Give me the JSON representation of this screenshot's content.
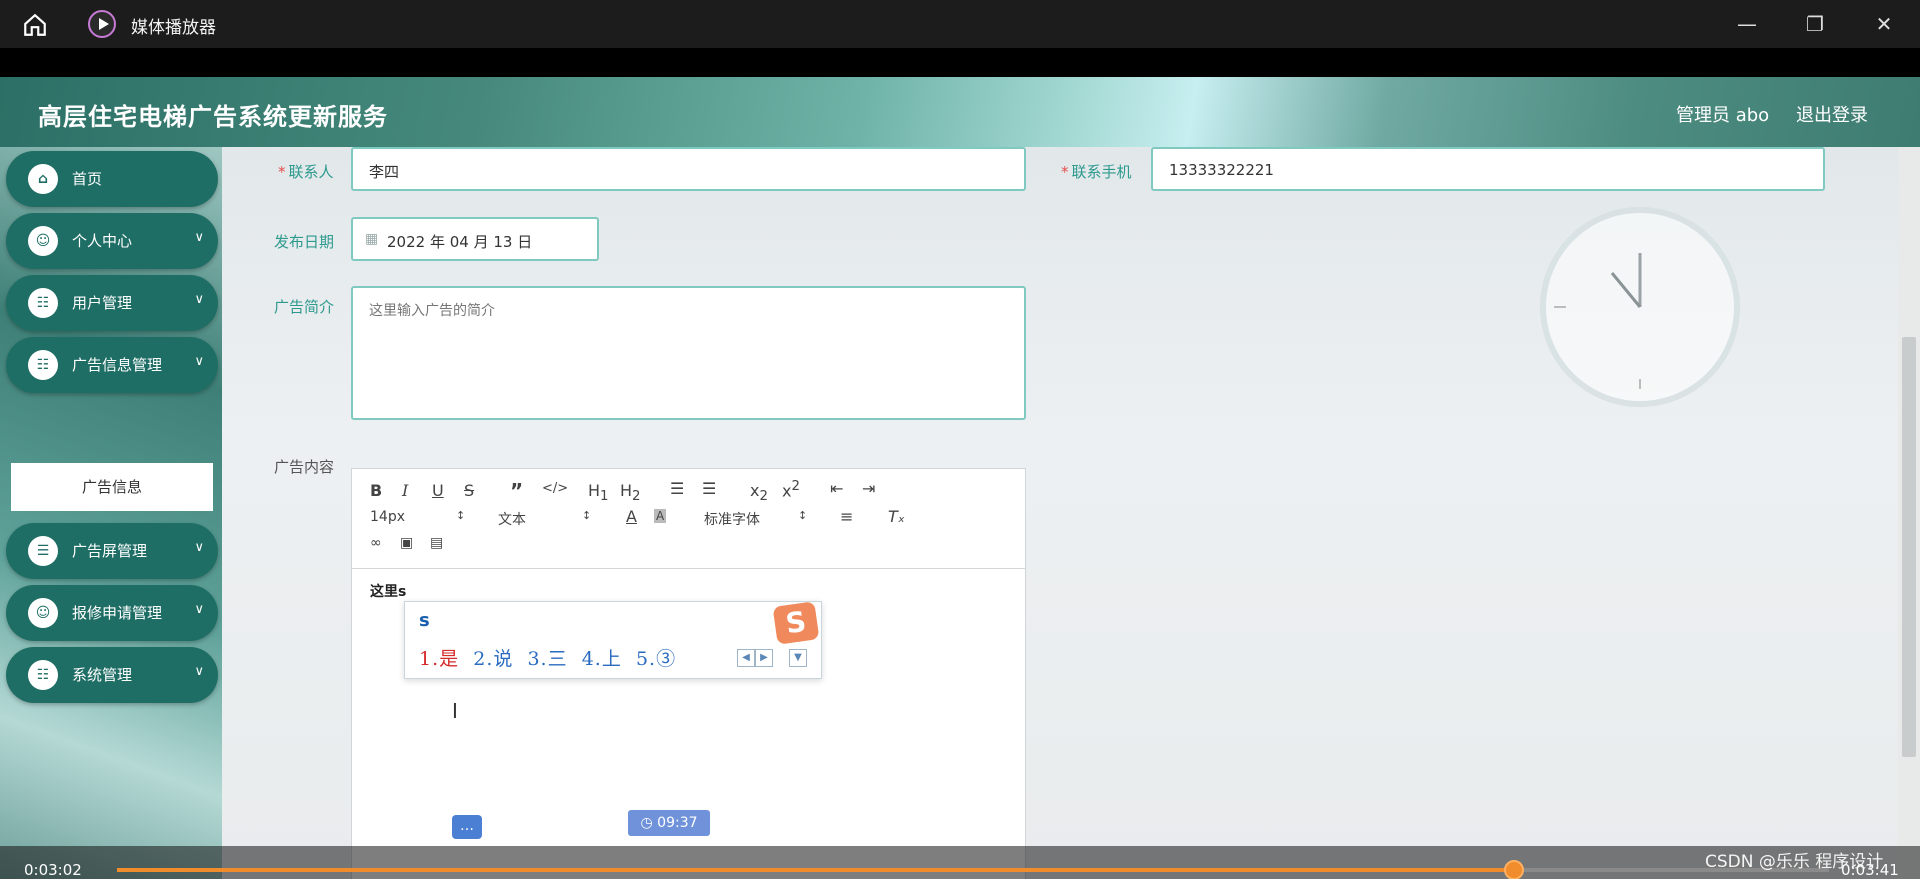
{
  "player": {
    "title": "媒体播放器",
    "current_time": "0:03:02",
    "total_time": "0:03:41",
    "progress": 0.816
  },
  "app": {
    "title": "高层住宅电梯广告系统更新服务",
    "admin_label": "管理员 abo",
    "logout_label": "退出登录"
  },
  "sidebar": {
    "items": [
      {
        "label": "首页",
        "icon": "home-icon"
      },
      {
        "label": "个人中心",
        "icon": "user-icon"
      },
      {
        "label": "用户管理",
        "icon": "grid-icon"
      },
      {
        "label": "广告信息管理",
        "icon": "grid-icon"
      },
      {
        "label": "广告屏管理",
        "icon": "list-icon"
      },
      {
        "label": "报修申请管理",
        "icon": "user-icon"
      },
      {
        "label": "系统管理",
        "icon": "grid-icon"
      }
    ],
    "sub_item": "广告信息"
  },
  "form": {
    "contact_label": "联系人",
    "contact_value": "李四",
    "phone_label": "联系手机",
    "phone_value": "13333322221",
    "date_label": "发布日期",
    "date_value": "2022 年 04 月 13 日",
    "intro_label": "广告简介",
    "intro_placeholder": "这里输入广告的简介",
    "content_label": "广告内容",
    "editor": {
      "font_size": "14px",
      "text_style": "文本",
      "font_family": "标准字体",
      "content": "这里s"
    }
  },
  "ime": {
    "composition": "s",
    "candidates": [
      "1.是",
      "2.说",
      "3.三",
      "4.上",
      "5.③"
    ]
  },
  "overlay": {
    "time_badge": "09:37"
  },
  "watermark": "CSDN @乐乐 程序设计",
  "colors": {
    "accent": "#1f6e65",
    "label": "#2d9a8e",
    "progress": "#f08c2b"
  }
}
